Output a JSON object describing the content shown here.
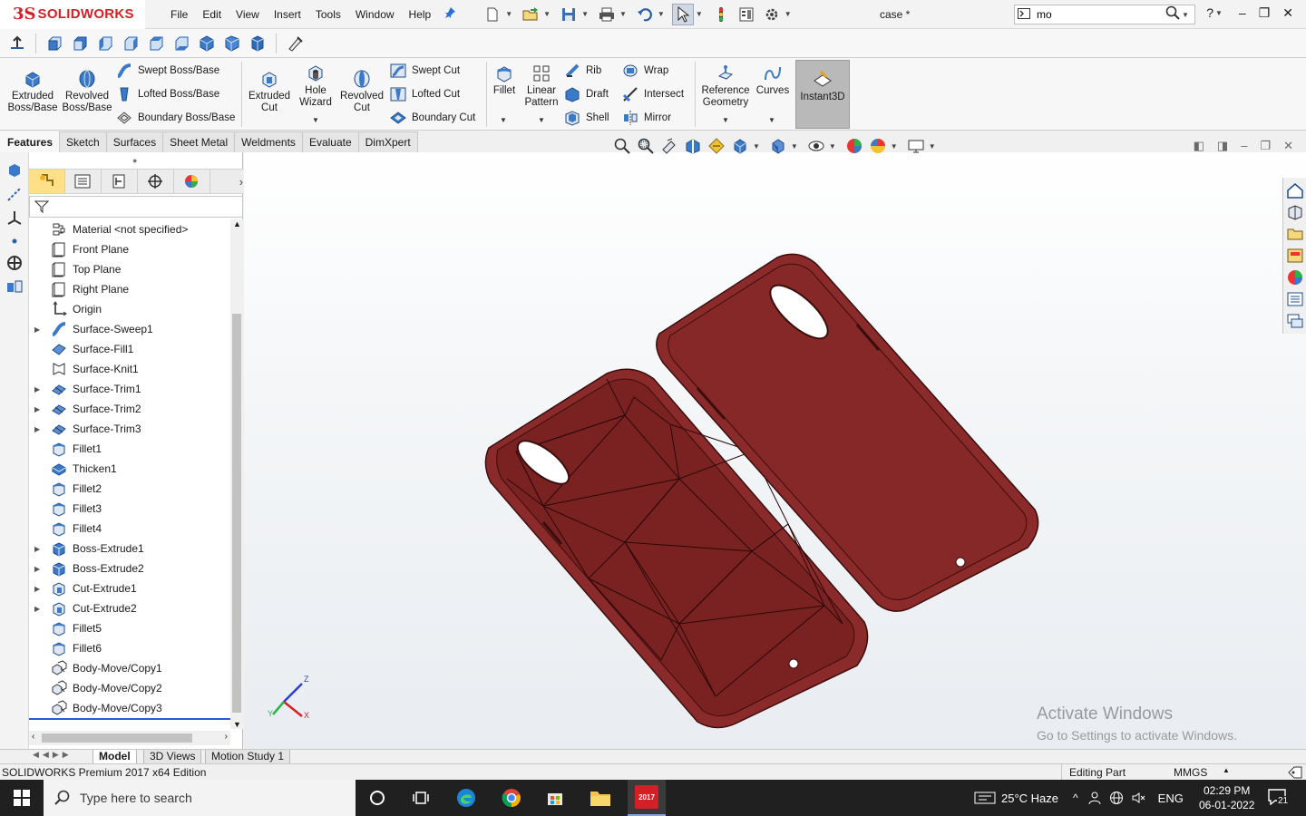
{
  "app": {
    "logo_ds": "3S",
    "logo_text": "SOLIDWORKS",
    "doc_title": "case *"
  },
  "menu": [
    "File",
    "Edit",
    "View",
    "Insert",
    "Tools",
    "Window",
    "Help"
  ],
  "search": {
    "value": "mo"
  },
  "command_manager": {
    "extruded_boss": [
      "Extruded",
      "Boss/Base"
    ],
    "revolved_boss": [
      "Revolved",
      "Boss/Base"
    ],
    "swept_boss": "Swept Boss/Base",
    "lofted_boss": "Lofted Boss/Base",
    "boundary_boss": "Boundary Boss/Base",
    "extruded_cut": [
      "Extruded",
      "Cut"
    ],
    "hole_wizard": [
      "Hole",
      "Wizard"
    ],
    "revolved_cut": [
      "Revolved",
      "Cut"
    ],
    "swept_cut": "Swept Cut",
    "lofted_cut": "Lofted Cut",
    "boundary_cut": "Boundary Cut",
    "fillet": "Fillet",
    "linear_pattern": [
      "Linear",
      "Pattern"
    ],
    "rib": "Rib",
    "draft": "Draft",
    "shell": "Shell",
    "wrap": "Wrap",
    "intersect": "Intersect",
    "mirror": "Mirror",
    "reference_geometry": [
      "Reference",
      "Geometry"
    ],
    "curves": "Curves",
    "instant3d": "Instant3D"
  },
  "cm_tabs": [
    "Features",
    "Sketch",
    "Surfaces",
    "Sheet Metal",
    "Weldments",
    "Evaluate",
    "DimXpert"
  ],
  "tree": [
    {
      "label": "Material <not specified>",
      "icon": "material-icon",
      "expand": false
    },
    {
      "label": "Front Plane",
      "icon": "plane-icon",
      "expand": false
    },
    {
      "label": "Top Plane",
      "icon": "plane-icon",
      "expand": false
    },
    {
      "label": "Right Plane",
      "icon": "plane-icon",
      "expand": false
    },
    {
      "label": "Origin",
      "icon": "origin-icon",
      "expand": false
    },
    {
      "label": "Surface-Sweep1",
      "icon": "surface-sweep-icon",
      "expand": true
    },
    {
      "label": "Surface-Fill1",
      "icon": "surface-fill-icon",
      "expand": false
    },
    {
      "label": "Surface-Knit1",
      "icon": "surface-knit-icon",
      "expand": false
    },
    {
      "label": "Surface-Trim1",
      "icon": "surface-trim-icon",
      "expand": true
    },
    {
      "label": "Surface-Trim2",
      "icon": "surface-trim-icon",
      "expand": true
    },
    {
      "label": "Surface-Trim3",
      "icon": "surface-trim-icon",
      "expand": true
    },
    {
      "label": "Fillet1",
      "icon": "fillet-icon",
      "expand": false
    },
    {
      "label": "Thicken1",
      "icon": "thicken-icon",
      "expand": false
    },
    {
      "label": "Fillet2",
      "icon": "fillet-icon",
      "expand": false
    },
    {
      "label": "Fillet3",
      "icon": "fillet-icon",
      "expand": false
    },
    {
      "label": "Fillet4",
      "icon": "fillet-icon",
      "expand": false
    },
    {
      "label": "Boss-Extrude1",
      "icon": "boss-extrude-icon",
      "expand": true
    },
    {
      "label": "Boss-Extrude2",
      "icon": "boss-extrude-icon",
      "expand": true
    },
    {
      "label": "Cut-Extrude1",
      "icon": "cut-extrude-icon",
      "expand": true
    },
    {
      "label": "Cut-Extrude2",
      "icon": "cut-extrude-icon",
      "expand": true
    },
    {
      "label": "Fillet5",
      "icon": "fillet-icon",
      "expand": false
    },
    {
      "label": "Fillet6",
      "icon": "fillet-icon",
      "expand": false
    },
    {
      "label": "Body-Move/Copy1",
      "icon": "move-copy-icon",
      "expand": false
    },
    {
      "label": "Body-Move/Copy2",
      "icon": "move-copy-icon",
      "expand": false
    },
    {
      "label": "Body-Move/Copy3",
      "icon": "move-copy-icon",
      "expand": false
    }
  ],
  "triad": {
    "x": "X",
    "y": "Y",
    "z": "Z"
  },
  "bottom_tabs": [
    "Model",
    "3D Views",
    "Motion Study 1"
  ],
  "status": {
    "edition": "SOLIDWORKS Premium 2017 x64 Edition",
    "mode": "Editing Part",
    "units": "MMGS"
  },
  "watermark": {
    "line1": "Activate Windows",
    "line2": "Go to Settings to activate Windows."
  },
  "taskbar": {
    "search_placeholder": "Type here to search",
    "weather": "25°C  Haze",
    "lang": "ENG",
    "time": "02:29 PM",
    "date": "06-01-2022",
    "notif_count": "21",
    "sw_badge": "2017"
  },
  "colors": {
    "model_fill": "#8b2a2a",
    "model_edge": "#3a0d0d",
    "accent": "#d32027",
    "instant3d_bg": "#b9b9b9"
  }
}
